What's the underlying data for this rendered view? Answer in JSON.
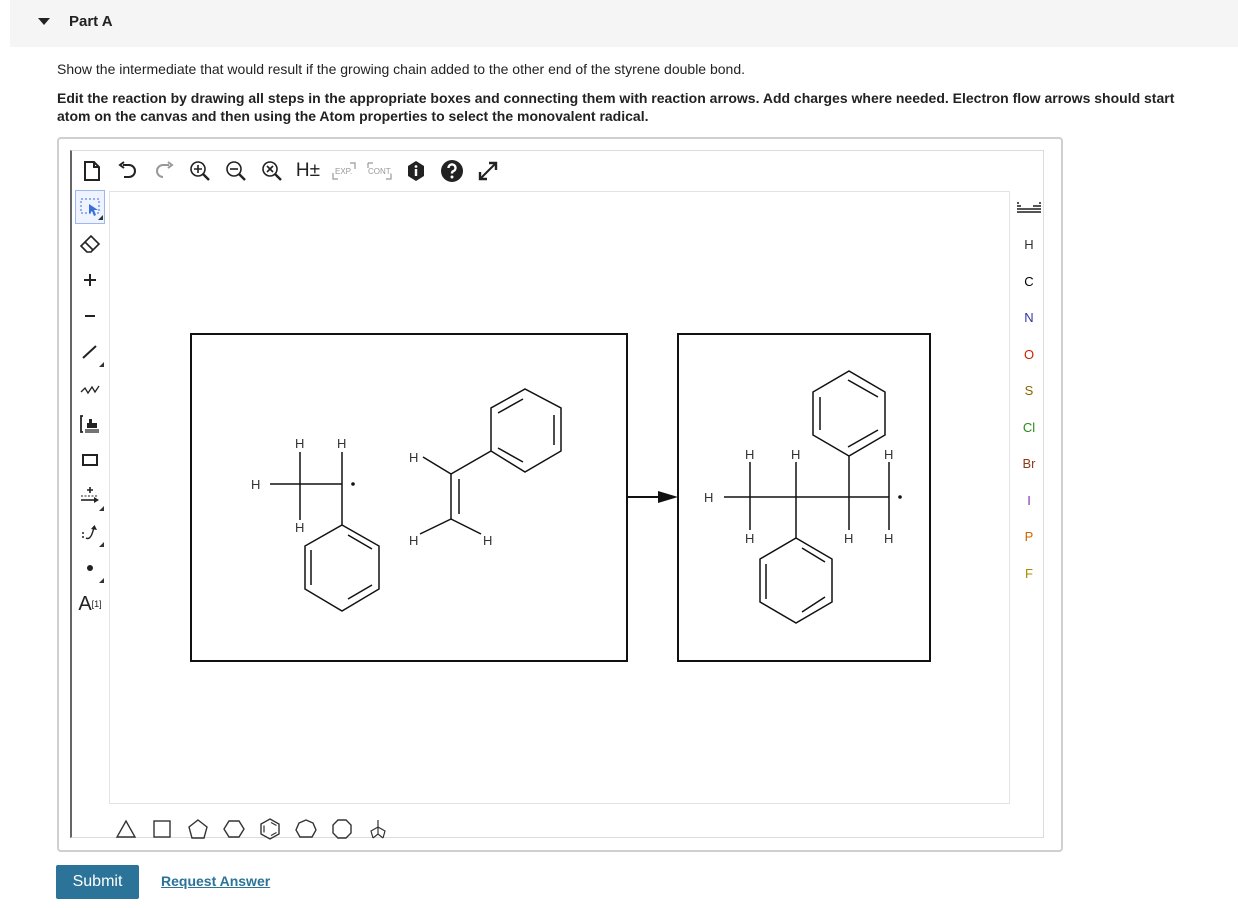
{
  "part": {
    "title": "Part A"
  },
  "instructions": {
    "line1": "Show the intermediate that would result if the growing chain added to the other end of the styrene double bond.",
    "bold_line1": "Edit the reaction by drawing all steps in the appropriate boxes and connecting them with reaction arrows. Add charges where needed. Electron flow arrows should start",
    "bold_line2": "atom on the canvas and then using the Atom properties to select the monovalent radical."
  },
  "top_toolbar": {
    "h_label": "H±",
    "exp_label": "EXP.",
    "cont_label": "CONT."
  },
  "left_toolbar": {
    "atom_label": "A",
    "atom_superscript": "[1]"
  },
  "periodic": {
    "elements": [
      {
        "symbol": "H",
        "color": "#333333"
      },
      {
        "symbol": "C",
        "color": "#000000"
      },
      {
        "symbol": "N",
        "color": "#3333aa"
      },
      {
        "symbol": "O",
        "color": "#cc2200"
      },
      {
        "symbol": "S",
        "color": "#886600"
      },
      {
        "symbol": "Cl",
        "color": "#2a8a1a"
      },
      {
        "symbol": "Br",
        "color": "#8b3a1a"
      },
      {
        "symbol": "I",
        "color": "#8833aa"
      },
      {
        "symbol": "P",
        "color": "#cc6600"
      },
      {
        "symbol": "F",
        "color": "#aa8800"
      }
    ]
  },
  "canvas": {
    "atom_h": "H"
  },
  "actions": {
    "submit": "Submit",
    "request_answer": "Request Answer"
  },
  "colors": {
    "submit_bg": "#2b7398",
    "active_tool_border": "#9bb7ec"
  }
}
